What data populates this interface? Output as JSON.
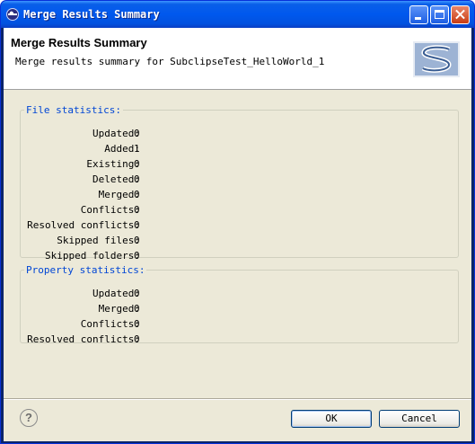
{
  "window": {
    "title": "Merge Results Summary"
  },
  "header": {
    "title": "Merge Results Summary",
    "description": "Merge results summary for SubclipseTest_HelloWorld_1",
    "logo_icon": "subversion-logo-icon"
  },
  "file_statistics": {
    "legend": "File statistics:",
    "rows": [
      {
        "label": "Updated:",
        "value": "0"
      },
      {
        "label": "Added:",
        "value": "1"
      },
      {
        "label": "Existing:",
        "value": "0"
      },
      {
        "label": "Deleted:",
        "value": "0"
      },
      {
        "label": "Merged:",
        "value": "0"
      },
      {
        "label": "Conflicts:",
        "value": "0"
      },
      {
        "label": "Resolved conflicts:",
        "value": "0"
      },
      {
        "label": "Skipped files:",
        "value": "0"
      },
      {
        "label": "Skipped folders:",
        "value": "0"
      }
    ]
  },
  "property_statistics": {
    "legend": "Property statistics:",
    "rows": [
      {
        "label": "Updated:",
        "value": "0"
      },
      {
        "label": "Merged:",
        "value": "0"
      },
      {
        "label": "Conflicts:",
        "value": "0"
      },
      {
        "label": "Resolved conflicts:",
        "value": "0"
      }
    ]
  },
  "footer": {
    "help_glyph": "?",
    "ok_label": "OK",
    "cancel_label": "Cancel"
  },
  "colors": {
    "titlebar": "#0058ee",
    "dialog_bg": "#ece9d8",
    "legend_text": "#0046d5"
  }
}
